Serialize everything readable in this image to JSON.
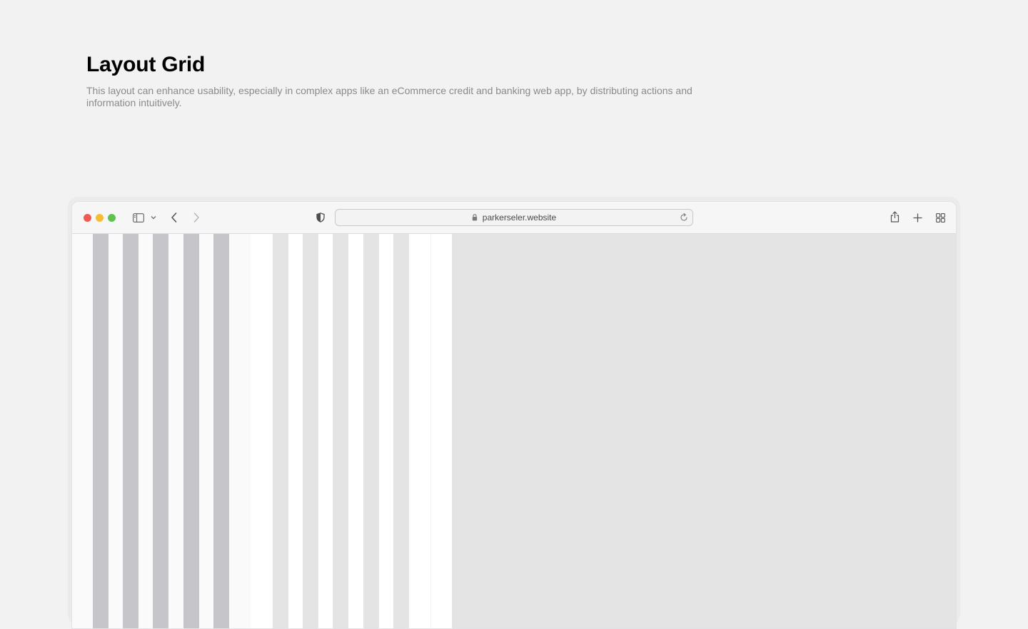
{
  "header": {
    "title": "Layout Grid",
    "description": "This layout can enhance usability, especially in complex apps like an eCommerce credit and banking web app, by distributing actions and information intuitively."
  },
  "browser": {
    "url": "parkerseler.website",
    "traffic_colors": {
      "close": "#ee5b52",
      "minimize": "#f5bd31",
      "maximize": "#5fc24f"
    },
    "icons": [
      "sidebar-icon",
      "chevron-down-icon",
      "back-icon",
      "forward-icon",
      "shield-icon",
      "lock-icon",
      "reload-icon",
      "share-icon",
      "plus-icon",
      "tabs-overview-icon"
    ]
  },
  "colors": {
    "background": "#f2f2f2",
    "dark_column": "#c6c6ca",
    "light_column": "#e4e4e5",
    "viewport_gray": "#e4e4e4"
  }
}
